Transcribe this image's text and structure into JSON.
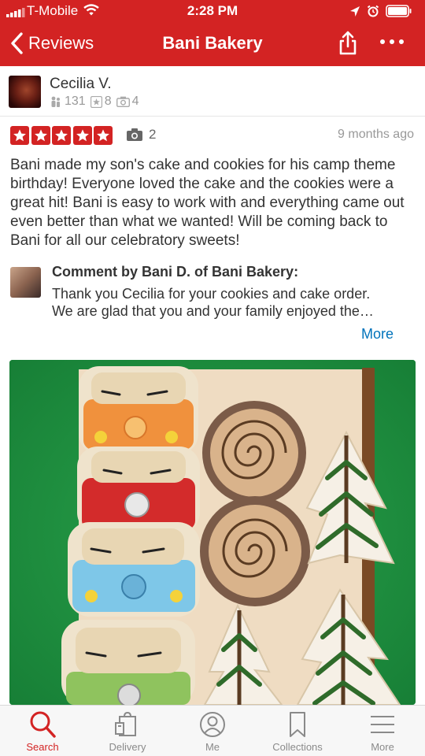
{
  "status_bar": {
    "carrier": "T-Mobile",
    "time": "2:28 PM"
  },
  "nav": {
    "back_label": "Reviews",
    "title": "Bani Bakery"
  },
  "reviewer": {
    "name": "Cecilia V.",
    "friends": "131",
    "reviews": "8",
    "photos": "4"
  },
  "review": {
    "stars": 5,
    "photo_count": "2",
    "date": "9 months ago",
    "text": "Bani made my son's cake and cookies for his camp theme birthday! Everyone loved the cake and the cookies were a great hit! Bani is easy to work with and everything came out even better than what we wanted! Will be coming back to Bani for all our celebratory sweets!"
  },
  "owner_comment": {
    "heading": "Comment by Bani D. of Bani Bakery:",
    "line1": "Thank you Cecilia for your cookies and cake order.",
    "line2": "We are glad that you and your family enjoyed the…",
    "more_label": "More"
  },
  "tabs": [
    {
      "label": "Search",
      "icon": "search-icon",
      "active": true
    },
    {
      "label": "Delivery",
      "icon": "delivery-bag-icon",
      "active": false
    },
    {
      "label": "Me",
      "icon": "profile-icon",
      "active": false
    },
    {
      "label": "Collections",
      "icon": "bookmark-icon",
      "active": false
    },
    {
      "label": "More",
      "icon": "menu-icon",
      "active": false
    }
  ],
  "colors": {
    "brand_red": "#d32323",
    "link_blue": "#0073bb"
  }
}
